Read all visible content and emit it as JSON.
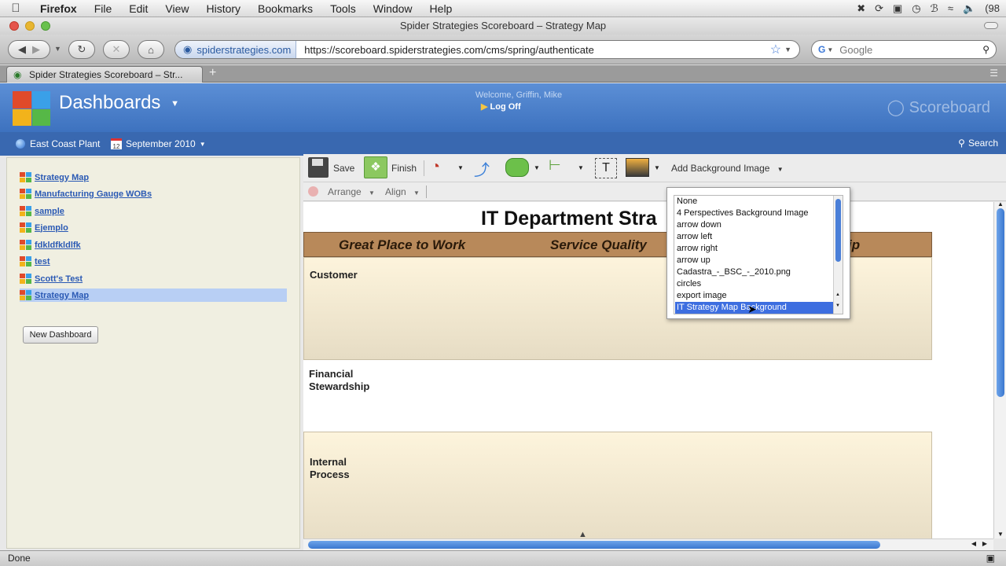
{
  "os_menubar": {
    "app": "Firefox",
    "items": [
      "File",
      "Edit",
      "View",
      "History",
      "Bookmarks",
      "Tools",
      "Window",
      "Help"
    ],
    "battery": "(98"
  },
  "window": {
    "title": "Spider Strategies Scoreboard – Strategy Map"
  },
  "navigation": {
    "site_identity": "spiderstrategies.com",
    "url": "https://scoreboard.spiderstrategies.com/cms/spring/authenticate",
    "search_placeholder": "Google"
  },
  "tabs": [
    {
      "label": "Spider Strategies Scoreboard – Str..."
    }
  ],
  "app_header": {
    "title": "Dashboards",
    "welcome": "Welcome, Griffin, Mike",
    "logoff": "Log Off",
    "brand": "Scoreboard",
    "logo_colors": [
      "#e04a2a",
      "#3aa0e8",
      "#f2b31b",
      "#56b847"
    ]
  },
  "context_bar": {
    "organization": "East Coast Plant",
    "period": "September 2010",
    "search": "Search",
    "calendar_day": "12"
  },
  "sidebar": {
    "items": [
      {
        "label": "Strategy Map"
      },
      {
        "label": "Manufacturing Gauge WOBs"
      },
      {
        "label": "sample"
      },
      {
        "label": "Ejemplo"
      },
      {
        "label": "fdkldfkldlfk"
      },
      {
        "label": "test"
      },
      {
        "label": "Scott's Test"
      },
      {
        "label": "Strategy Map"
      }
    ],
    "selected_index": 7,
    "new_dashboard_label": "New Dashboard"
  },
  "toolbar": {
    "save_label": "Save",
    "finish_label": "Finish",
    "text_tool_glyph": "T",
    "add_background_label": "Add Background Image",
    "arrange_label": "Arrange",
    "align_label": "Align"
  },
  "canvas": {
    "title": "IT Department Stra",
    "perspectives": [
      "Great Place to Work",
      "Service Quality",
      "ip"
    ],
    "rows": [
      "Customer",
      "Financial Stewardship",
      "Internal Process"
    ]
  },
  "bg_dropdown": {
    "options": [
      "None",
      "4 Perspectives Background Image",
      "arrow down",
      "arrow left",
      "arrow right",
      "arrow up",
      "Cadastra_-_BSC_-_2010.png",
      "circles",
      "export image",
      "IT Strategy Map Background"
    ],
    "selected_index": 9
  },
  "status": {
    "text": "Done"
  },
  "colors": {
    "header_blue": "#4a80cc",
    "context_blue": "#3968b0",
    "perspective_band": "#b8895a",
    "selection_blue": "#3d6ee0"
  }
}
